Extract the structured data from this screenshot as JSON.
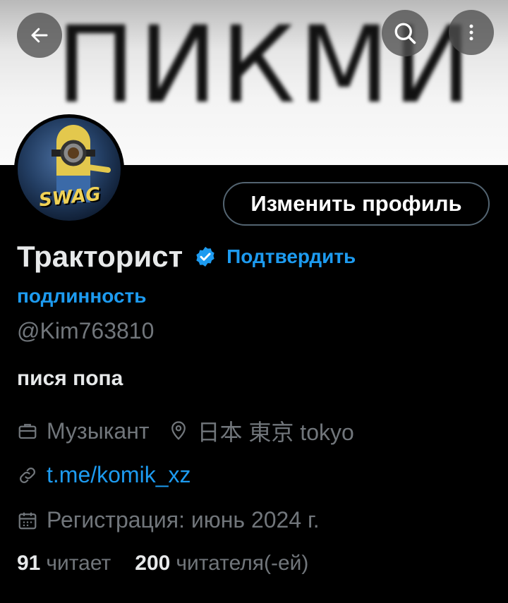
{
  "banner": {
    "text": "ПИКМИ"
  },
  "nav": {
    "back_icon": "arrow-left-icon",
    "search_icon": "search-icon",
    "more_icon": "more-vertical-icon"
  },
  "profile": {
    "avatar_text": "SWAG",
    "edit_button": "Изменить профиль",
    "display_name": "Тракторист",
    "verify_link_line1": "Подтвердить",
    "verify_link_line2": "подлинность",
    "handle": "@Kim763810",
    "bio": "пися попа",
    "profession": "Музыкант",
    "location": "日本 東京 tokyo",
    "website": "t.me/komik_xz",
    "joined": "Регистрация: июнь 2024 г.",
    "following_count": "91",
    "following_label": "читает",
    "followers_count": "200",
    "followers_label": "читателя(-ей)"
  },
  "colors": {
    "accent": "#1d9bf0",
    "muted": "#71767b",
    "text": "#e7e9ea",
    "background": "#000000"
  }
}
